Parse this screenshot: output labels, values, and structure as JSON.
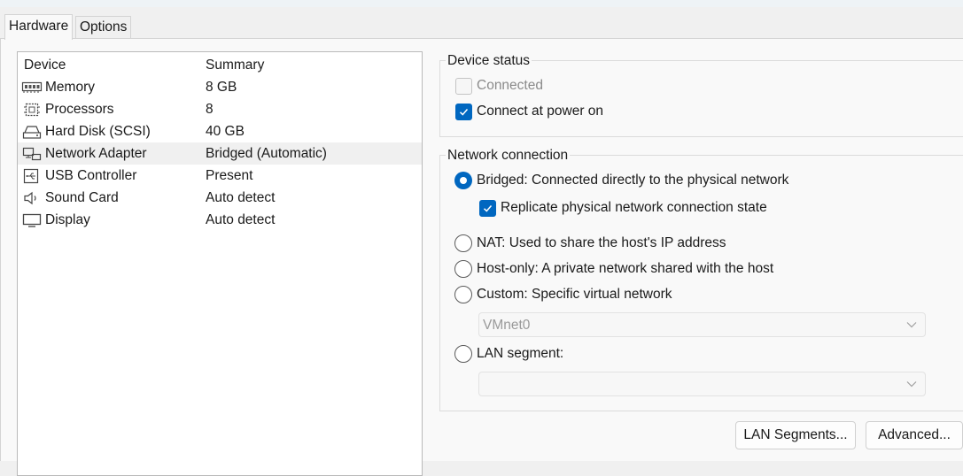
{
  "tabs": [
    {
      "label": "Hardware",
      "active": true
    },
    {
      "label": "Options",
      "active": false
    }
  ],
  "device_list": {
    "columns": {
      "device": "Device",
      "summary": "Summary"
    },
    "rows": [
      {
        "name": "Memory",
        "summary": "8 GB",
        "icon": "memory-icon",
        "selected": false
      },
      {
        "name": "Processors",
        "summary": "8",
        "icon": "processor-icon",
        "selected": false
      },
      {
        "name": "Hard Disk (SCSI)",
        "summary": "40 GB",
        "icon": "hard-disk-icon",
        "selected": false
      },
      {
        "name": "Network Adapter",
        "summary": "Bridged (Automatic)",
        "icon": "network-adapter-icon",
        "selected": true
      },
      {
        "name": "USB Controller",
        "summary": "Present",
        "icon": "usb-icon",
        "selected": false
      },
      {
        "name": "Sound Card",
        "summary": "Auto detect",
        "icon": "speaker-icon",
        "selected": false
      },
      {
        "name": "Display",
        "summary": "Auto detect",
        "icon": "monitor-icon",
        "selected": false
      }
    ]
  },
  "device_status": {
    "title": "Device status",
    "connected": {
      "label": "Connected",
      "checked": false,
      "enabled": false
    },
    "connect_at_power_on": {
      "label": "Connect at power on",
      "checked": true,
      "enabled": true
    }
  },
  "network_connection": {
    "title": "Network connection",
    "options": {
      "bridged": {
        "label": "Bridged: Connected directly to the physical network",
        "selected": true
      },
      "replicate": {
        "label": "Replicate physical network connection state",
        "checked": true
      },
      "nat": {
        "label": "NAT: Used to share the host's IP address",
        "selected": false
      },
      "host_only": {
        "label": "Host-only: A private network shared with the host",
        "selected": false
      },
      "custom": {
        "label": "Custom: Specific virtual network",
        "selected": false
      },
      "lan_segment": {
        "label": "LAN segment:",
        "selected": false
      }
    },
    "custom_network_value": "VMnet0",
    "lan_segment_value": ""
  },
  "buttons": {
    "lan_segments": "LAN Segments...",
    "advanced": "Advanced..."
  },
  "colors": {
    "accent": "#0067c0",
    "selected_row": "#f0f0f0"
  }
}
